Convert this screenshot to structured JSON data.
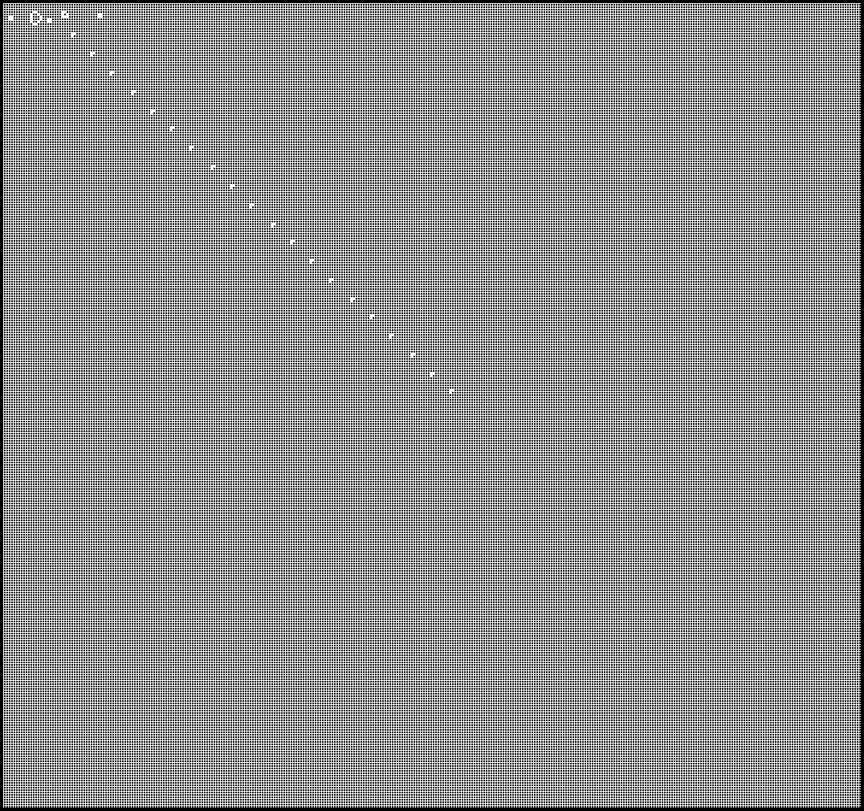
{
  "simulation": {
    "type": "cellular-automaton-grid",
    "colors": {
      "background": "#000000",
      "grid_line": "#ffffff",
      "live_cell": "#ffffff",
      "dead_cell": "#000000"
    },
    "cell_layout": {
      "columns": 356,
      "rows": 334
    },
    "live_cells": [
      [
        2,
        5
      ],
      [
        3,
        5
      ],
      [
        2,
        6
      ],
      [
        3,
        6
      ],
      [
        12,
        3
      ],
      [
        13,
        3
      ],
      [
        11,
        4
      ],
      [
        14,
        4
      ],
      [
        11,
        5
      ],
      [
        15,
        5
      ],
      [
        11,
        6
      ],
      [
        15,
        6
      ],
      [
        11,
        7
      ],
      [
        14,
        7
      ],
      [
        12,
        8
      ],
      [
        13,
        8
      ],
      [
        18,
        6
      ],
      [
        19,
        6
      ],
      [
        18,
        7
      ],
      [
        19,
        7
      ],
      [
        24,
        3
      ],
      [
        25,
        3
      ],
      [
        24,
        4
      ],
      [
        26,
        4
      ],
      [
        24,
        5
      ],
      [
        25,
        5
      ],
      [
        26,
        5
      ],
      [
        39,
        4
      ],
      [
        40,
        4
      ],
      [
        39,
        5
      ],
      [
        40,
        5
      ],
      [
        28,
        12
      ],
      [
        29,
        12
      ],
      [
        28,
        13
      ],
      [
        36,
        20
      ],
      [
        37,
        20
      ],
      [
        36,
        21
      ],
      [
        44,
        28
      ],
      [
        45,
        28
      ],
      [
        44,
        29
      ],
      [
        53,
        36
      ],
      [
        54,
        36
      ],
      [
        53,
        37
      ],
      [
        61,
        44
      ],
      [
        62,
        44
      ],
      [
        61,
        45
      ],
      [
        69,
        51
      ],
      [
        70,
        51
      ],
      [
        69,
        52
      ],
      [
        77,
        59
      ],
      [
        78,
        59
      ],
      [
        77,
        60
      ],
      [
        86,
        67
      ],
      [
        87,
        67
      ],
      [
        86,
        68
      ],
      [
        94,
        75
      ],
      [
        95,
        75
      ],
      [
        94,
        76
      ],
      [
        102,
        83
      ],
      [
        103,
        83
      ],
      [
        102,
        84
      ],
      [
        111,
        91
      ],
      [
        112,
        91
      ],
      [
        111,
        92
      ],
      [
        119,
        98
      ],
      [
        120,
        98
      ],
      [
        119,
        99
      ],
      [
        127,
        106
      ],
      [
        128,
        106
      ],
      [
        127,
        107
      ],
      [
        135,
        114
      ],
      [
        136,
        114
      ],
      [
        135,
        115
      ],
      [
        144,
        122
      ],
      [
        145,
        122
      ],
      [
        144,
        123
      ],
      [
        152,
        129
      ],
      [
        153,
        129
      ],
      [
        152,
        130
      ],
      [
        160,
        137
      ],
      [
        161,
        137
      ],
      [
        160,
        138
      ],
      [
        169,
        145
      ],
      [
        170,
        145
      ],
      [
        169,
        146
      ],
      [
        177,
        153
      ],
      [
        178,
        153
      ],
      [
        177,
        154
      ],
      [
        185,
        160
      ],
      [
        186,
        160
      ],
      [
        185,
        161
      ]
    ]
  }
}
